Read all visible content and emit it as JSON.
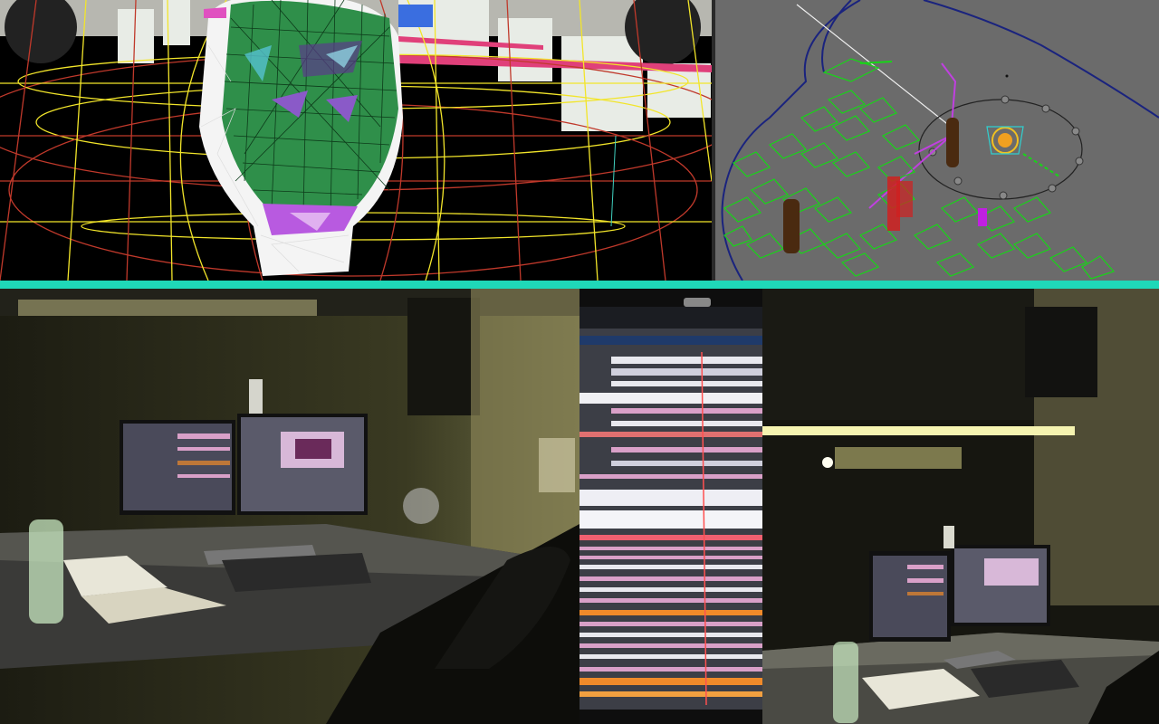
{
  "collage": {
    "accent_divider_color": "#1fd8b8",
    "panels": [
      {
        "id": "face-wireframe-viewport"
      },
      {
        "id": "scene-top-viewport"
      },
      {
        "id": "desk-photo"
      },
      {
        "id": "monitor-closeup-photo"
      },
      {
        "id": "room-photo"
      }
    ]
  },
  "colors": {
    "wire_yellow": "#f2e52a",
    "wire_red": "#c0392b",
    "mesh_green": "#2f8f4a",
    "scene_bg": "#6b6b6b",
    "scene_green": "#17d617",
    "scene_blue": "#1a237e",
    "timeline_pink": "#d9a0c8",
    "timeline_orange": "#f08a2a",
    "lamp_glow": "#f5f3b0"
  }
}
